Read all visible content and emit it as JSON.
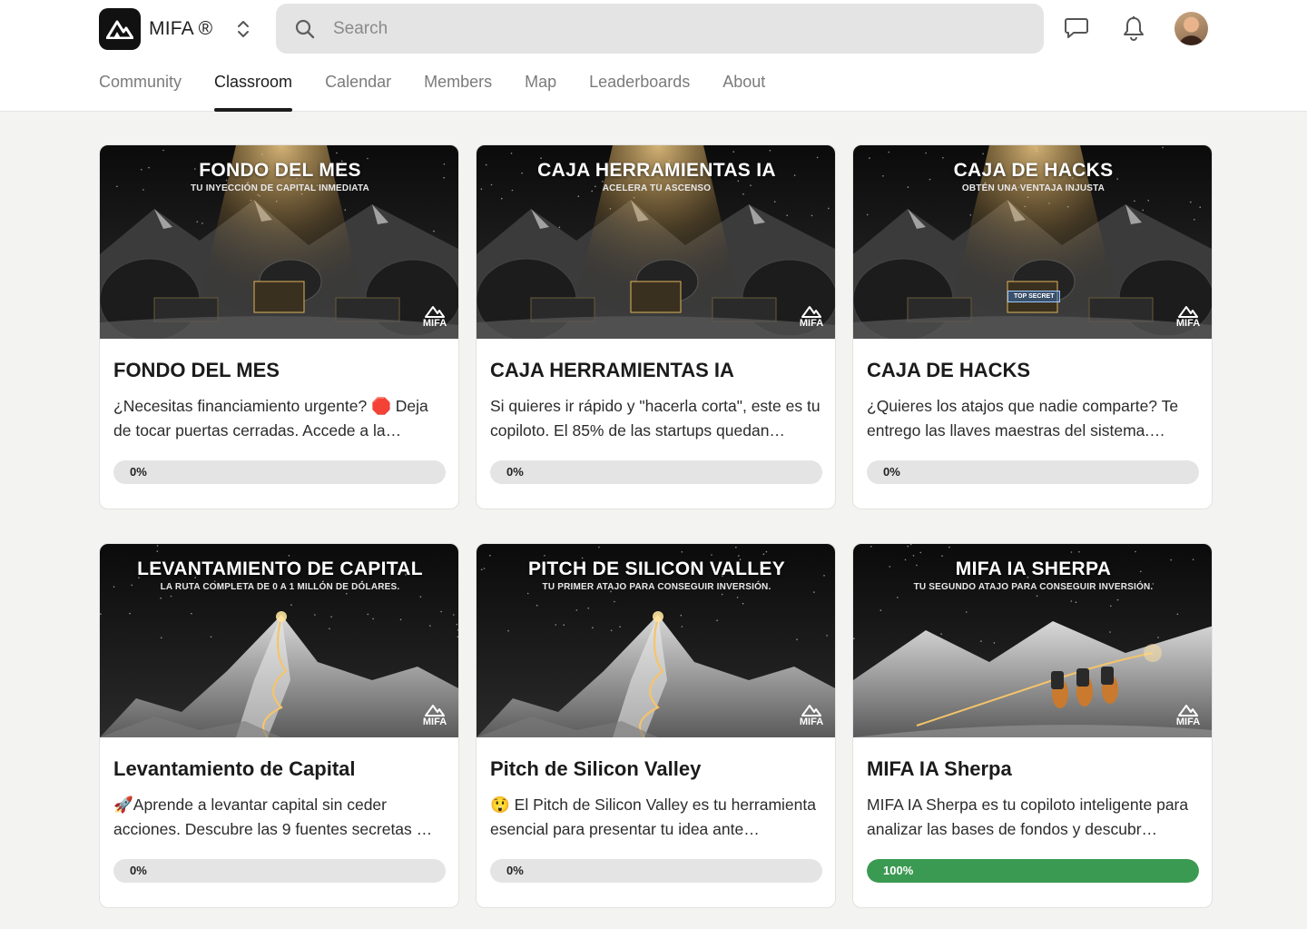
{
  "header": {
    "brand": "MIFA ®",
    "search_placeholder": "Search"
  },
  "nav": {
    "tabs": [
      {
        "label": "Community",
        "active": false
      },
      {
        "label": "Classroom",
        "active": true
      },
      {
        "label": "Calendar",
        "active": false
      },
      {
        "label": "Members",
        "active": false
      },
      {
        "label": "Map",
        "active": false
      },
      {
        "label": "Leaderboards",
        "active": false
      },
      {
        "label": "About",
        "active": false
      }
    ]
  },
  "courses": [
    {
      "cover_title": "FONDO DEL MES",
      "cover_subtitle": "TU INYECCIÓN DE CAPITAL INMEDIATA",
      "cover_scene": "dome-camp",
      "title": "FONDO DEL MES",
      "description": "¿Necesitas financiamiento urgente? 🛑 Deja de tocar puertas cerradas. Accede a la…",
      "progress": 0,
      "progress_label": "0%"
    },
    {
      "cover_title": "CAJA HERRAMIENTAS IA",
      "cover_subtitle": "ACELERA TU ASCENSO",
      "cover_scene": "dome-camp",
      "title": "CAJA HERRAMIENTAS IA",
      "description": "Si quieres ir rápido y \"hacerla corta\", este es tu copiloto. El 85% de las startups quedan…",
      "progress": 0,
      "progress_label": "0%"
    },
    {
      "cover_title": "CAJA DE HACKS",
      "cover_subtitle": "OBTÉN UNA VENTAJA INJUSTA",
      "cover_scene": "dome-camp",
      "cover_badge": "TOP SECRET",
      "title": "CAJA DE HACKS",
      "description": "¿Quieres los atajos que nadie comparte? Te entrego las llaves maestras del sistema.…",
      "progress": 0,
      "progress_label": "0%"
    },
    {
      "cover_title": "LEVANTAMIENTO DE CAPITAL",
      "cover_subtitle": "LA RUTA COMPLETA DE 0 A 1 MILLÓN DE DÓLARES.",
      "cover_scene": "mountain",
      "title": "Levantamiento de Capital",
      "description": "🚀Aprende a levantar capital sin ceder acciones. Descubre las 9 fuentes secretas …",
      "progress": 0,
      "progress_label": "0%"
    },
    {
      "cover_title": "PITCH DE SILICON VALLEY",
      "cover_subtitle": "TU PRIMER ATAJO PARA CONSEGUIR INVERSIÓN.",
      "cover_scene": "mountain",
      "title": "Pitch de Silicon Valley",
      "description": "😲 El Pitch de Silicon Valley es tu herramienta esencial para presentar tu idea ante…",
      "progress": 0,
      "progress_label": "0%"
    },
    {
      "cover_title": "MIFA IA SHERPA",
      "cover_subtitle": "TU SEGUNDO ATAJO PARA CONSEGUIR INVERSIÓN.",
      "cover_scene": "climbers",
      "title": "MIFA IA Sherpa",
      "description": "MIFA IA Sherpa es tu copiloto inteligente para analizar las bases de fondos y descubr…",
      "progress": 1,
      "progress_label": "100%"
    }
  ],
  "cover_logo_text": "MIFA",
  "colors": {
    "progress_fill": "#3b9a52",
    "progress_track": "#e4e4e4",
    "glow": "#f3c66b"
  }
}
